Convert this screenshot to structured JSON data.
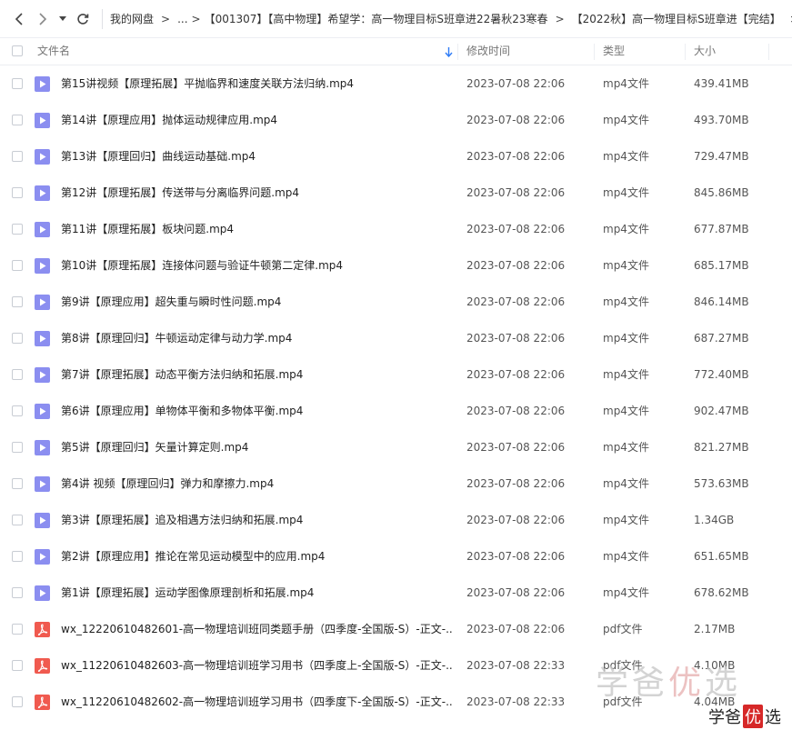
{
  "breadcrumb": {
    "items": [
      "我的网盘",
      "...",
      "【001307】【高中物理】希望学：高一物理目标S班章进22暑秋23寒春",
      "【2022秋】高一物理目标S班章进【完结】"
    ],
    "separator": ">",
    "more": ">"
  },
  "table": {
    "headers": {
      "name": "文件名",
      "time": "修改时间",
      "type": "类型",
      "size": "大小"
    },
    "rows": [
      {
        "icon": "video-file-icon",
        "name": "第15讲视频【原理拓展】平抛临界和速度关联方法归纳.mp4",
        "time": "2023-07-08 22:06",
        "type": "mp4文件",
        "size": "439.41MB"
      },
      {
        "icon": "video-file-icon",
        "name": "第14讲【原理应用】抛体运动规律应用.mp4",
        "time": "2023-07-08 22:06",
        "type": "mp4文件",
        "size": "493.70MB"
      },
      {
        "icon": "video-file-icon",
        "name": "第13讲【原理回归】曲线运动基础.mp4",
        "time": "2023-07-08 22:06",
        "type": "mp4文件",
        "size": "729.47MB"
      },
      {
        "icon": "video-file-icon",
        "name": "第12讲【原理拓展】传送带与分离临界问题.mp4",
        "time": "2023-07-08 22:06",
        "type": "mp4文件",
        "size": "845.86MB"
      },
      {
        "icon": "video-file-icon",
        "name": "第11讲【原理拓展】板块问题.mp4",
        "time": "2023-07-08 22:06",
        "type": "mp4文件",
        "size": "677.87MB"
      },
      {
        "icon": "video-file-icon",
        "name": "第10讲【原理拓展】连接体问题与验证牛顿第二定律.mp4",
        "time": "2023-07-08 22:06",
        "type": "mp4文件",
        "size": "685.17MB"
      },
      {
        "icon": "video-file-icon",
        "name": "第9讲【原理应用】超失重与瞬时性问题.mp4",
        "time": "2023-07-08 22:06",
        "type": "mp4文件",
        "size": "846.14MB"
      },
      {
        "icon": "video-file-icon",
        "name": "第8讲【原理回归】牛顿运动定律与动力学.mp4",
        "time": "2023-07-08 22:06",
        "type": "mp4文件",
        "size": "687.27MB"
      },
      {
        "icon": "video-file-icon",
        "name": "第7讲【原理拓展】动态平衡方法归纳和拓展.mp4",
        "time": "2023-07-08 22:06",
        "type": "mp4文件",
        "size": "772.40MB"
      },
      {
        "icon": "video-file-icon",
        "name": "第6讲【原理应用】单物体平衡和多物体平衡.mp4",
        "time": "2023-07-08 22:06",
        "type": "mp4文件",
        "size": "902.47MB"
      },
      {
        "icon": "video-file-icon",
        "name": "第5讲【原理回归】矢量计算定则.mp4",
        "time": "2023-07-08 22:06",
        "type": "mp4文件",
        "size": "821.27MB"
      },
      {
        "icon": "video-file-icon",
        "name": "第4讲 视频【原理回归】弹力和摩擦力.mp4",
        "time": "2023-07-08 22:06",
        "type": "mp4文件",
        "size": "573.63MB"
      },
      {
        "icon": "video-file-icon",
        "name": "第3讲【原理拓展】追及相遇方法归纳和拓展.mp4",
        "time": "2023-07-08 22:06",
        "type": "mp4文件",
        "size": "1.34GB"
      },
      {
        "icon": "video-file-icon",
        "name": "第2讲【原理应用】推论在常见运动模型中的应用.mp4",
        "time": "2023-07-08 22:06",
        "type": "mp4文件",
        "size": "651.65MB"
      },
      {
        "icon": "video-file-icon",
        "name": "第1讲【原理拓展】运动学图像原理剖析和拓展.mp4",
        "time": "2023-07-08 22:06",
        "type": "mp4文件",
        "size": "678.62MB"
      },
      {
        "icon": "pdf-file-icon",
        "name": "wx_12220610482601-高一物理培训班同类题手册（四季度-全国版-S）-正文-...",
        "time": "2023-07-08 22:06",
        "type": "pdf文件",
        "size": "2.17MB"
      },
      {
        "icon": "pdf-file-icon",
        "name": "wx_11220610482603-高一物理培训班学习用书（四季度上-全国版-S）-正文-...",
        "time": "2023-07-08 22:33",
        "type": "pdf文件",
        "size": "4.10MB"
      },
      {
        "icon": "pdf-file-icon",
        "name": "wx_11220610482602-高一物理培训班学习用书（四季度下-全国版-S）-正文-...",
        "time": "2023-07-08 22:33",
        "type": "pdf文件",
        "size": "4.04MB"
      }
    ]
  },
  "watermark": {
    "big_a": "学爸",
    "big_b": "优",
    "big_c": "选",
    "small_a": "学爸",
    "small_b": "优",
    "small_c": "选"
  },
  "colors": {
    "video_icon": "#8b8ef0",
    "pdf_icon": "#f05a4f",
    "sort_arrow": "#2f7cf6"
  }
}
